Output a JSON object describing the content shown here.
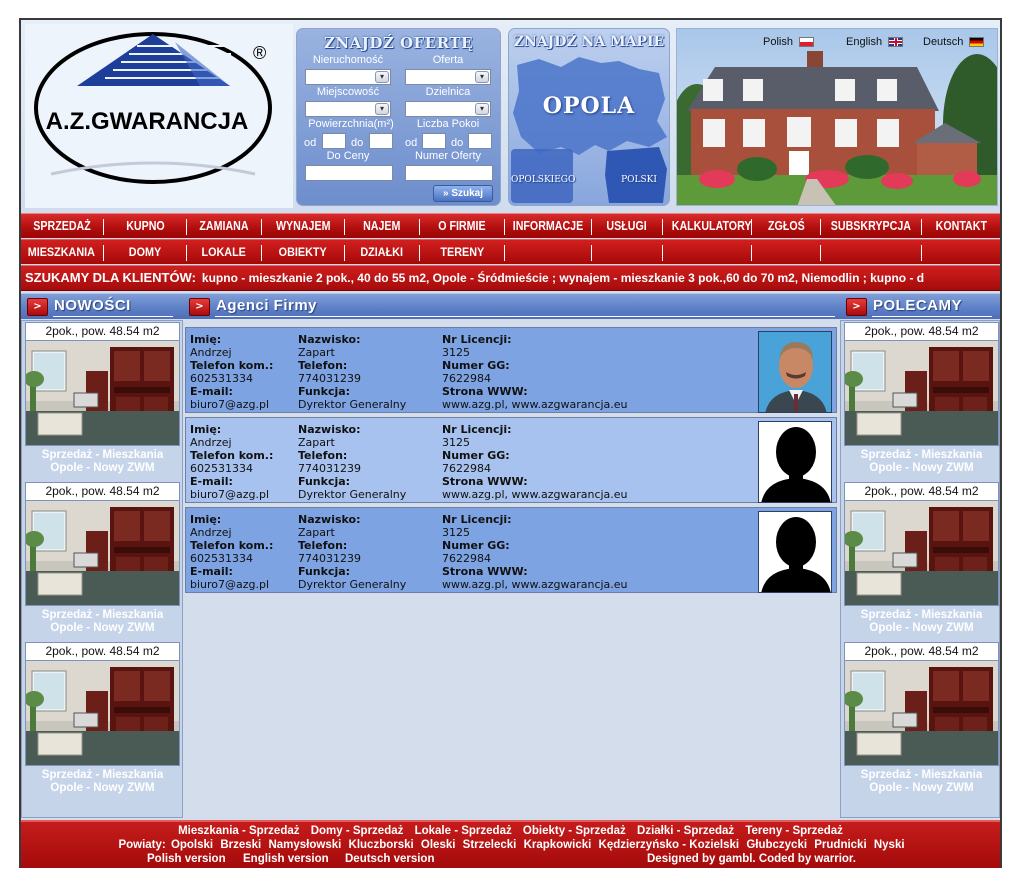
{
  "brand": {
    "name": "A.Z.GWARANCJA",
    "registered": "®"
  },
  "languages": [
    {
      "label": "Polish"
    },
    {
      "label": "English"
    },
    {
      "label": "Deutsch"
    }
  ],
  "search": {
    "title": "ZNAJDŹ OFERTĘ",
    "property_label": "Nieruchomość",
    "offer_label": "Oferta",
    "city_label": "Miejscowość",
    "district_label": "Dzielnica",
    "area_label": "Powierzchnia(m²)",
    "rooms_label": "Liczba Pokoi",
    "from_label": "od",
    "to_label": "do",
    "price_label": "Do Ceny",
    "offer_no_label": "Numer Oferty",
    "button_label": "» Szukaj"
  },
  "map": {
    "title": "ZNAJDŹ NA MAPIE",
    "city": "OPOLA",
    "region_left": "OPOLSKIEGO",
    "region_right": "POLSKI"
  },
  "nav_main": [
    "SPRZEDAŻ",
    "KUPNO",
    "ZAMIANA",
    "WYNAJEM",
    "NAJEM",
    "O FIRMIE",
    "INFORMACJE",
    "USŁUGI",
    "KALKULATORY",
    "ZGŁOŚ",
    "SUBSKRYPCJA",
    "KONTAKT"
  ],
  "nav_sub": [
    "MIESZKANIA",
    "DOMY",
    "LOKALE",
    "OBIEKTY",
    "DZIAŁKI",
    "TERENY"
  ],
  "ticker": {
    "label": "SZUKAMY DLA KLIENTÓW:",
    "text": "kupno - mieszkanie 2 pok., 40 do 55 m2, Opole - Śródmieście ; wynajem - mieszkanie 3 pok.,60 do 70 m2, Niemodlin ; kupno - d"
  },
  "left_column": {
    "title": "NOWOŚCI",
    "cards": [
      {
        "title": "2pok., pow. 48.54 m2",
        "caption_1": "Sprzedaż - Mieszkania",
        "caption_2": "Opole - Nowy ZWM"
      },
      {
        "title": "2pok., pow. 48.54 m2",
        "caption_1": "Sprzedaż - Mieszkania",
        "caption_2": "Opole - Nowy ZWM"
      },
      {
        "title": "2pok., pow. 48.54 m2",
        "caption_1": "Sprzedaż - Mieszkania",
        "caption_2": "Opole - Nowy ZWM"
      }
    ]
  },
  "right_column": {
    "title": "POLECAMY",
    "cards": [
      {
        "title": "2pok., pow. 48.54 m2",
        "caption_1": "Sprzedaż - Mieszkania",
        "caption_2": "Opole - Nowy ZWM"
      },
      {
        "title": "2pok., pow. 48.54 m2",
        "caption_1": "Sprzedaż - Mieszkania",
        "caption_2": "Opole - Nowy ZWM"
      },
      {
        "title": "2pok., pow. 48.54 m2",
        "caption_1": "Sprzedaż - Mieszkania",
        "caption_2": "Opole - Nowy ZWM"
      }
    ]
  },
  "agents": {
    "title": "Agenci Firmy",
    "labels": {
      "first_name": "Imię:",
      "last_name": "Nazwisko:",
      "license": "Nr Licencji:",
      "mobile": "Telefon kom.:",
      "phone": "Telefon:",
      "gg": "Numer GG:",
      "email": "E-mail:",
      "function": "Funkcja:",
      "www": "Strona WWW:"
    },
    "list": [
      {
        "first_name": "Andrzej",
        "last_name": "Zapart",
        "license": "3125",
        "mobile": "602531334",
        "phone": "774031239",
        "gg": "7622984",
        "email": "biuro7@azg.pl",
        "function": "Dyrektor Generalny",
        "www": "www.azg.pl, www.azgwarancja.eu"
      },
      {
        "first_name": "Andrzej",
        "last_name": "Zapart",
        "license": "3125",
        "mobile": "602531334",
        "phone": "774031239",
        "gg": "7622984",
        "email": "biuro7@azg.pl",
        "function": "Dyrektor Generalny",
        "www": "www.azg.pl, www.azgwarancja.eu"
      },
      {
        "first_name": "Andrzej",
        "last_name": "Zapart",
        "license": "3125",
        "mobile": "602531334",
        "phone": "774031239",
        "gg": "7622984",
        "email": "biuro7@azg.pl",
        "function": "Dyrektor Generalny",
        "www": "www.azg.pl, www.azgwarancja.eu"
      }
    ]
  },
  "footer": {
    "sections": [
      "Mieszkania - Sprzedaż",
      "Domy - Sprzedaż",
      "Lokale - Sprzedaż",
      "Obiekty - Sprzedaż",
      "Działki - Sprzedaż",
      "Tereny - Sprzedaż"
    ],
    "districts_label": "Powiaty:",
    "districts": [
      "Opolski",
      "Brzeski",
      "Namysłowski",
      "Kluczborski",
      "Oleski",
      "Strzelecki",
      "Krapkowicki",
      "Kędzierzyńsko - Kozielski",
      "Głubczycki",
      "Prudnicki",
      "Nyski"
    ],
    "versions": [
      "Polish version",
      "English version",
      "Deutsch version"
    ],
    "credits": "Designed by gambl. Coded by warrior."
  },
  "colors": {
    "nav_red": "#b00d0d",
    "panel_blue": "#5e80c6",
    "agent_dark": "#7ea3e3",
    "agent_light": "#a7c2ee"
  }
}
